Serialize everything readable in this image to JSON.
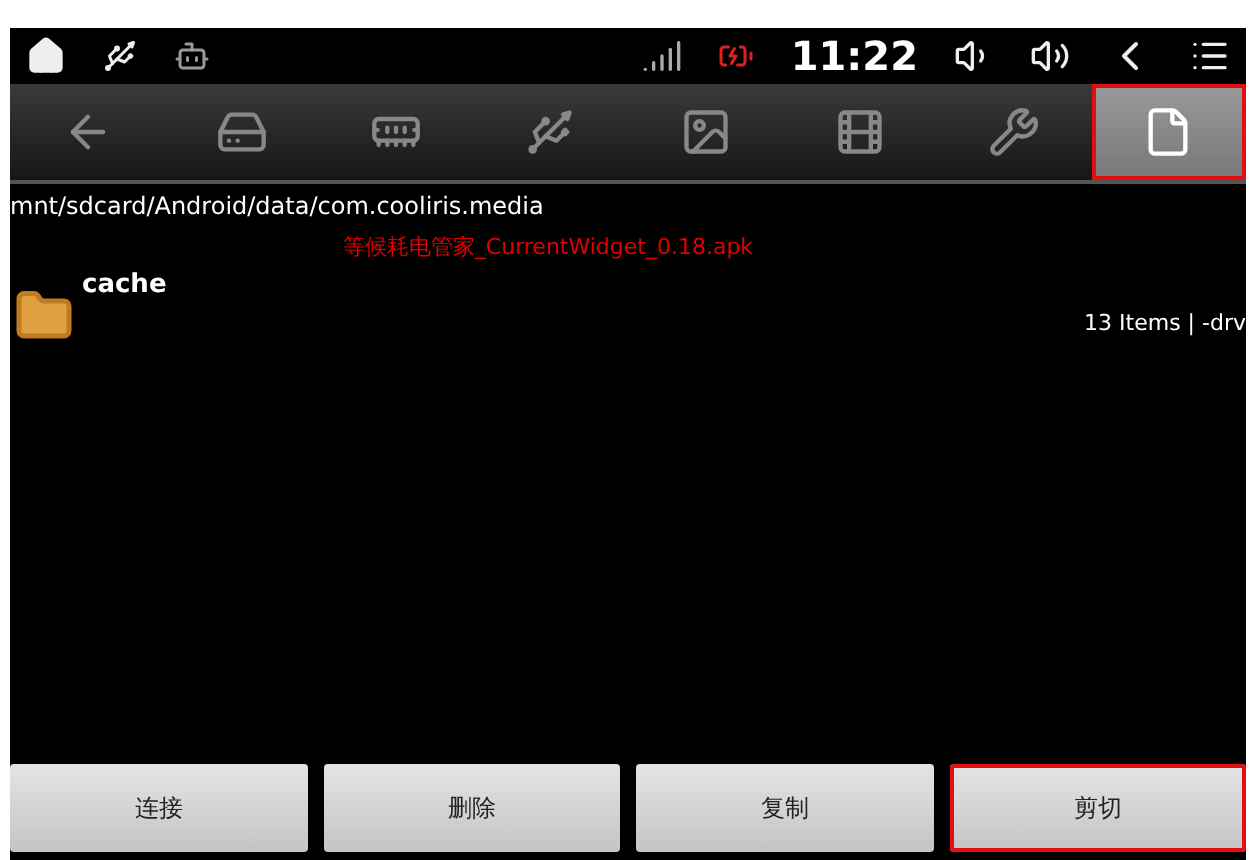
{
  "status_bar": {
    "time": "11:22"
  },
  "toolbar": [
    {
      "kind": "back",
      "selected": false,
      "highlighted": false
    },
    {
      "kind": "disk",
      "selected": false,
      "highlighted": false
    },
    {
      "kind": "sd",
      "selected": false,
      "highlighted": false
    },
    {
      "kind": "usb",
      "selected": false,
      "highlighted": false
    },
    {
      "kind": "image",
      "selected": false,
      "highlighted": false
    },
    {
      "kind": "film",
      "selected": false,
      "highlighted": false
    },
    {
      "kind": "wrench",
      "selected": false,
      "highlighted": false
    },
    {
      "kind": "file",
      "selected": true,
      "highlighted": true
    }
  ],
  "path": "mnt/sdcard/Android/data/com.cooliris.media",
  "notice": "等候耗电管家_CurrentWidget_0.18.apk",
  "files": [
    {
      "name": "cache",
      "info": "13 Items | -drv"
    }
  ],
  "buttons": [
    {
      "label": "连接",
      "highlighted": false
    },
    {
      "label": "删除",
      "highlighted": false
    },
    {
      "label": "复制",
      "highlighted": false
    },
    {
      "label": "剪切",
      "highlighted": true
    }
  ]
}
